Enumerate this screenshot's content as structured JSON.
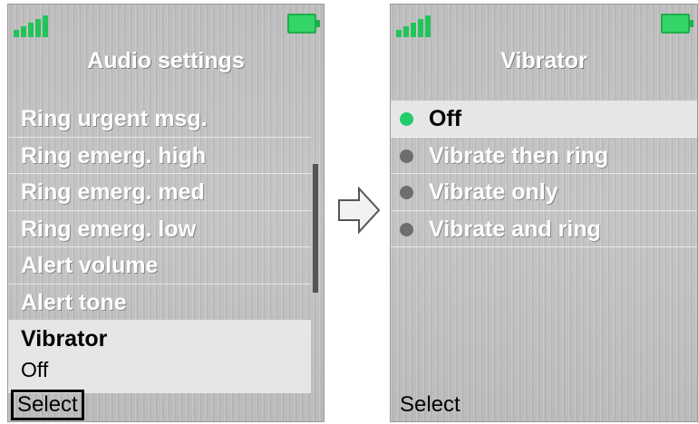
{
  "left_screen": {
    "title": "Audio settings",
    "items": [
      {
        "label": "Ring urgent msg."
      },
      {
        "label": "Ring emerg. high"
      },
      {
        "label": "Ring emerg. med"
      },
      {
        "label": "Ring emerg. low"
      },
      {
        "label": "Alert volume"
      },
      {
        "label": "Alert tone"
      }
    ],
    "selected_item": {
      "label": "Vibrator",
      "value": "Off"
    },
    "softkey": "Select"
  },
  "right_screen": {
    "title": "Vibrator",
    "options": [
      {
        "label": "Off",
        "selected": true
      },
      {
        "label": "Vibrate then ring",
        "selected": false
      },
      {
        "label": "Vibrate only",
        "selected": false
      },
      {
        "label": "Vibrate and ring",
        "selected": false
      }
    ],
    "softkey": "Select"
  },
  "colors": {
    "accent_green": "#22c45a",
    "selected_bg": "#e6e6e6"
  },
  "icons": [
    "signal-icon",
    "battery-icon",
    "arrow-right-icon",
    "radio-icon"
  ]
}
